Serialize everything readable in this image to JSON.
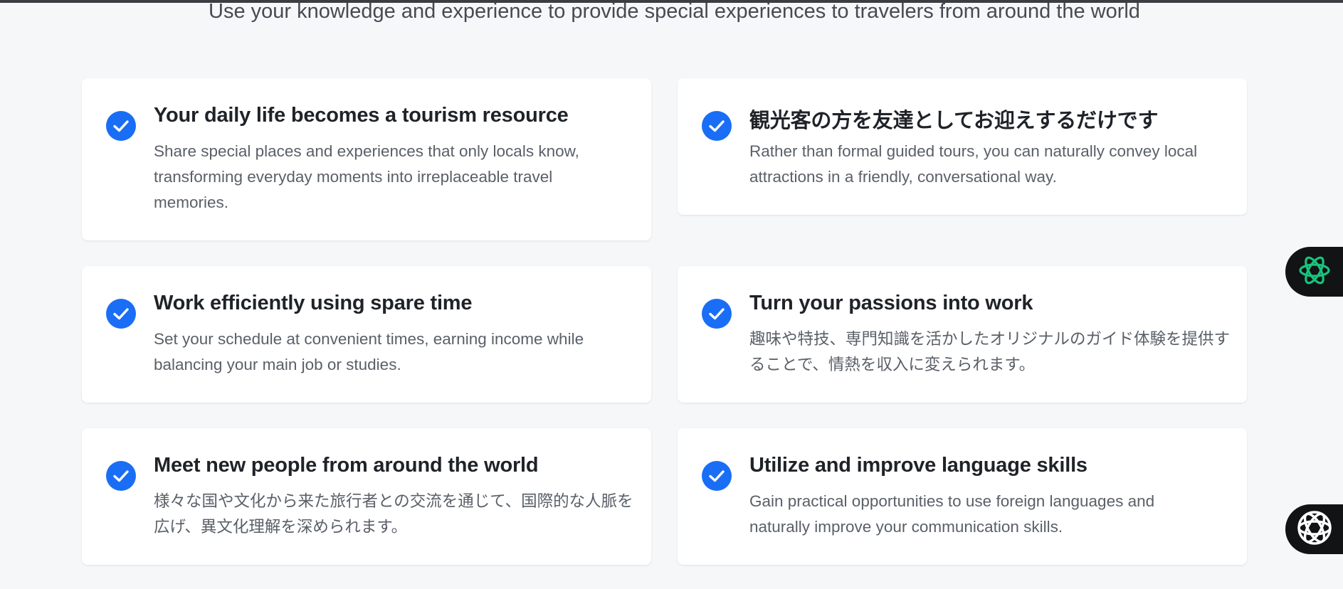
{
  "header": {
    "subtitle": "Use your knowledge and experience to provide special experiences to travelers from around the world"
  },
  "cards": [
    {
      "title": "Your daily life becomes a tourism resource",
      "description": "Share special places and experiences that only locals know, transforming everyday moments into irreplaceable travel memories."
    },
    {
      "title": "観光客の方を友達としてお迎えするだけです",
      "description": "Rather than formal guided tours, you can naturally convey local attractions in a friendly, conversational way."
    },
    {
      "title": "Work efficiently using spare time",
      "description": "Set your schedule at convenient times, earning income while balancing your main job or studies."
    },
    {
      "title": "Turn your passions into work",
      "description": "趣味や特技、専門知識を活かしたオリジナルのガイド体験を提供することで、情熱を収入に変えられます。"
    },
    {
      "title": "Meet new people from around the world",
      "description": "様々な国や文化から来た旅行者との交流を通じて、国際的な人脈を広げ、異文化理解を深められます。"
    },
    {
      "title": "Utilize and improve language skills",
      "description": "Gain practical opportunities to use foreign languages and naturally improve your communication skills."
    }
  ],
  "icons": {
    "check": "check-circle-icon",
    "assistant_1": "openai-logo-icon",
    "assistant_2": "assistant-logo-icon"
  },
  "colors": {
    "accent": "#1a6ef5",
    "assistant_green": "#19c37d",
    "background": "#f6f7f9"
  }
}
